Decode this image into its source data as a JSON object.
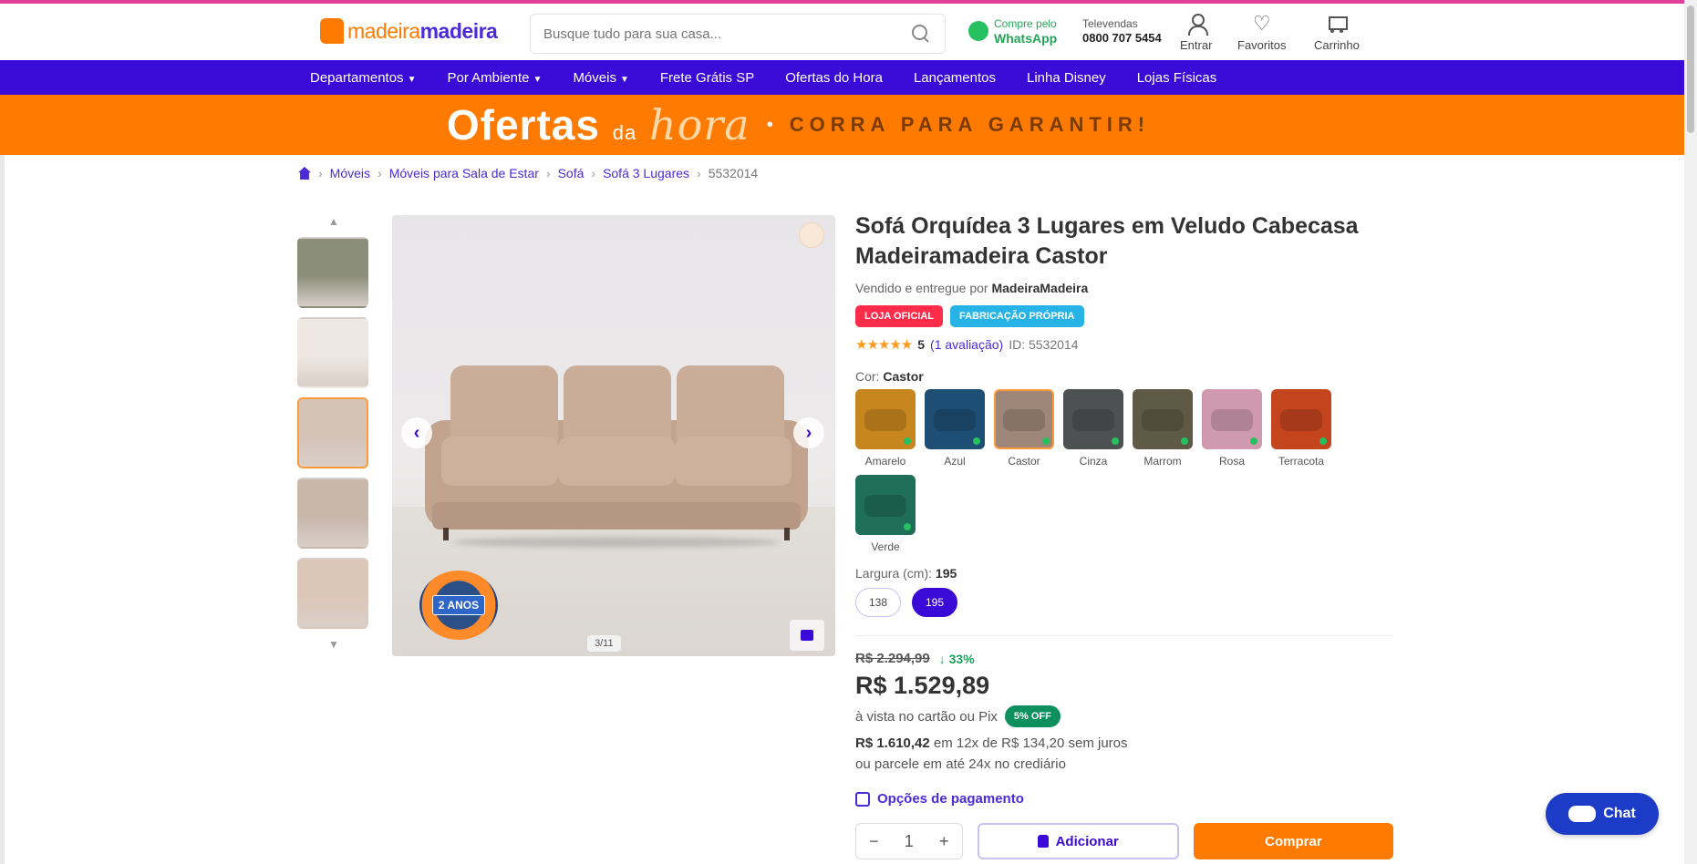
{
  "header": {
    "logo_text": "madeiramadeira",
    "logo_part1": "madeira",
    "logo_part2": "madeira",
    "search_placeholder": "Busque tudo para sua casa...",
    "whatsapp_line1": "Compre pelo",
    "whatsapp_line2": "WhatsApp",
    "phone_line1": "Televendas",
    "phone_line2": "0800 707 5454",
    "actions": [
      {
        "label": "Entrar",
        "icon": "user-icon"
      },
      {
        "label": "Favoritos",
        "icon": "heart-icon"
      },
      {
        "label": "Carrinho",
        "icon": "cart-icon"
      }
    ]
  },
  "nav": {
    "items": [
      {
        "label": "Departamentos",
        "caret": true
      },
      {
        "label": "Por Ambiente",
        "caret": true
      },
      {
        "label": "Móveis",
        "caret": true
      },
      {
        "label": "Frete Grátis SP",
        "caret": false
      },
      {
        "label": "Ofertas do Hora",
        "caret": false
      },
      {
        "label": "Lançamentos",
        "caret": false
      },
      {
        "label": "Linha Disney",
        "caret": false
      },
      {
        "label": "Lojas Físicas",
        "caret": false
      }
    ]
  },
  "promo": {
    "title_main": "Ofertas",
    "title_small": "da",
    "title_script": "hora",
    "subtitle": "CORRA PARA GARANTIR!"
  },
  "breadcrumb": {
    "items": [
      "Móveis",
      "Móveis para Sala de Estar",
      "Sofá",
      "Sofá 3 Lugares"
    ],
    "current": "5532014"
  },
  "gallery": {
    "thumb_colors": [
      "#8a8e7a",
      "#efe7e1",
      "#d5c3b7",
      "#c8b7ab",
      "#dcc6b7"
    ],
    "active_thumb": 3,
    "warranty_text": "2 ANOS",
    "counter": "3/11"
  },
  "product": {
    "title": "Sofá Orquídea 3 Lugares em Veludo Cabecasa Madeiramadeira Castor",
    "seller_prefix": "Vendido e entregue por",
    "seller_name": "MadeiraMadeira",
    "badges": [
      "LOJA OFICIAL",
      "FABRICAÇÃO PRÓPRIA"
    ],
    "stars": "★★★★★",
    "rating": "5",
    "reviews": "(1 avaliação)",
    "product_id": "ID: 5532014",
    "color_label": "Cor:",
    "color_selected": "Castor",
    "colors": [
      {
        "name": "Amarelo",
        "hex": "#c8861e",
        "active": false
      },
      {
        "name": "Azul",
        "hex": "#1e4e74",
        "active": false
      },
      {
        "name": "Castor",
        "hex": "#9e8678",
        "active": true
      },
      {
        "name": "Cinza",
        "hex": "#4e5152",
        "active": false
      },
      {
        "name": "Marrom",
        "hex": "#5f5a45",
        "active": false
      },
      {
        "name": "Rosa",
        "hex": "#cf9aae",
        "active": false
      },
      {
        "name": "Terracota",
        "hex": "#c4441e",
        "active": false
      },
      {
        "name": "Verde",
        "hex": "#1f6e58",
        "active": false
      }
    ],
    "length_label": "Largura (cm):",
    "length_selected": "195",
    "lengths": [
      {
        "label": "138",
        "active": false
      },
      {
        "label": "195",
        "active": true
      }
    ],
    "old_price": "R$ 2.294,99",
    "discount": "↓ 33%",
    "price": "R$ 1.529,89",
    "pix_text": "à vista no cartão ou Pix",
    "pix_badge": "5% OFF",
    "installment_amount": "R$ 1.610,42",
    "installment_text": "em 12x de R$ 134,20 sem juros",
    "installment_line2": "ou parcele em até 24x no crediário",
    "payment_options": "Opções de pagamento",
    "qty": "1",
    "qty_minus": "−",
    "qty_plus": "+",
    "add_label": "Adicionar",
    "buy_label": "Comprar"
  },
  "chat": {
    "label": "Chat"
  }
}
